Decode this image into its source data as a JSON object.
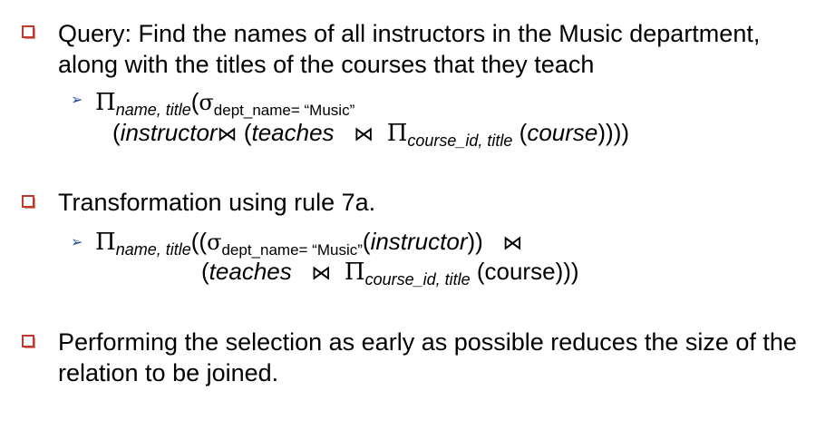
{
  "bullets": [
    {
      "line1": "Query: Find the names of all instructors in the Music department,",
      "line2": "along with the titles of the courses that they teach"
    },
    {
      "line1": "Transformation using rule 7a."
    },
    {
      "line1": "Performing the selection as early as possible reduces the size of the",
      "line2": "relation to be joined."
    }
  ],
  "expr1": {
    "pi": "Π",
    "proj": "name, title",
    "open": "(",
    "sigma": "σ",
    "cond": "dept_name= “Music”",
    "l2_open": "(",
    "rel1": "instructor",
    "join": "⋈",
    "paren": " (",
    "rel2": "teaches",
    "join2": "⋈",
    "pi2": "Π",
    "proj2": "course_id, title",
    "rel3open": " (",
    "rel3": "course",
    "close": "))))"
  },
  "expr2": {
    "pi": "Π",
    "proj": "name, title",
    "open": "((",
    "sigma": "σ",
    "cond": "dept_name= “Music”",
    "rel1open": "(",
    "rel1": "instructor",
    "rel1close": "))",
    "join": "⋈",
    "l2_open": "(",
    "rel2": "teaches",
    "join2": "⋈",
    "pi2": "Π",
    "proj2": "course_id, title",
    "rel3open": " (",
    "rel3": "course",
    "close": ")))"
  },
  "colors": {
    "bullet": "#c0392b",
    "arrow": "#1f4e9c"
  },
  "icons": {
    "bullet": "square-bullet-icon",
    "arrow": "arrow-bullet-icon"
  }
}
